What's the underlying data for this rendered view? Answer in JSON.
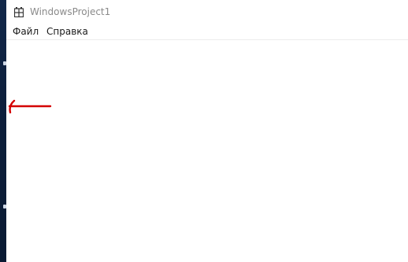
{
  "window": {
    "title": "WindowsProject1",
    "icon": "app-grid-icon"
  },
  "menu": {
    "items": [
      {
        "label": "Файл"
      },
      {
        "label": "Справка"
      }
    ]
  },
  "annotation": {
    "icon": "left-arrow-icon",
    "color": "#d40000"
  },
  "colors": {
    "title_text": "#8a8a8a",
    "menu_text": "#1a1a1a",
    "client_bg": "#ffffff",
    "desktop": "#0b1a33"
  }
}
